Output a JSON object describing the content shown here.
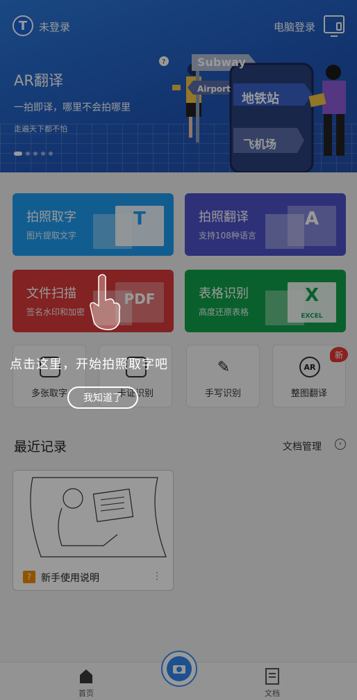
{
  "header": {
    "logo_letter": "T",
    "login_label": "未登录",
    "pc_login_label": "电脑登录"
  },
  "banner": {
    "title": "AR翻译",
    "subtitle": "一拍即译，哪里不会拍哪里",
    "tagline": "走遍天下都不怕",
    "signs": [
      "Subway",
      "Airport",
      "地铁站",
      "飞机场"
    ],
    "dots_count": 5,
    "active_dot": 0
  },
  "tools": {
    "photo_text": {
      "title": "拍照取字",
      "subtitle": "图片提取文字",
      "icon_letter": "T",
      "color": "#1e9bf0"
    },
    "photo_translate": {
      "title": "拍照翻译",
      "subtitle": "支持108种语言",
      "icon_letter": "A",
      "color": "#4d53c8"
    },
    "file_scan": {
      "title": "文件扫描",
      "subtitle": "签名水印和加密",
      "icon_letter": "PDF",
      "color": "#d93a3a"
    },
    "table_recognize": {
      "title": "表格识别",
      "subtitle": "高度还原表格",
      "icon_letter": "X",
      "icon_sub": "EXCEL",
      "color": "#12a04a"
    }
  },
  "small_tools": [
    {
      "label": "多张取字",
      "icon": "image-stack-icon"
    },
    {
      "label": "卡证识别",
      "icon": "id-card-icon"
    },
    {
      "label": "手写识别",
      "icon": "pen-icon"
    },
    {
      "label": "整图翻译",
      "icon": "AR",
      "badge": "新"
    }
  ],
  "recent": {
    "title": "最近记录",
    "manage_label": "文档管理",
    "items": [
      {
        "name": "新手使用说明",
        "badge": "?"
      }
    ]
  },
  "tabbar": {
    "home": "首页",
    "docs": "文档"
  },
  "guide": {
    "hint": "点击这里，开始拍照取字吧",
    "button": "我知道了"
  }
}
